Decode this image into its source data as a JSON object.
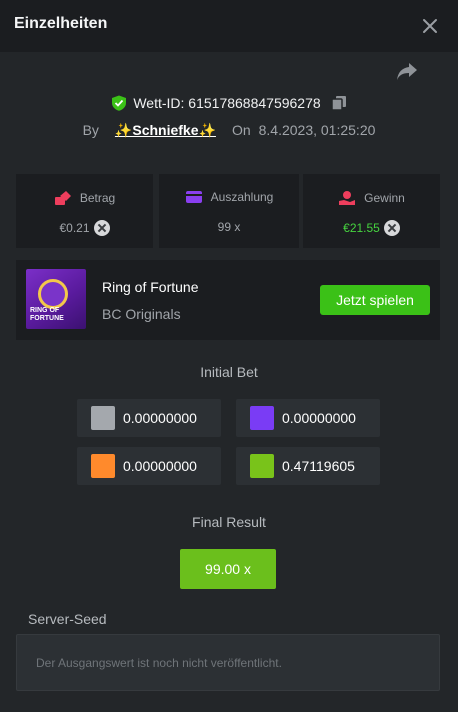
{
  "header": {
    "title": "Einzelheiten"
  },
  "bet": {
    "id_text": "Wett-ID: 61517868847596278",
    "by_label": "By",
    "user": "✨Schniefke✨",
    "on_label": "On",
    "timestamp": "8.4.2023, 01:25:20"
  },
  "stats": {
    "betrag": {
      "label": "Betrag",
      "value": "€0.21"
    },
    "auszahlung": {
      "label": "Auszahlung",
      "value": "99 x"
    },
    "gewinn": {
      "label": "Gewinn",
      "value": "€21.55"
    }
  },
  "game": {
    "name": "Ring of Fortune",
    "provider": "BC Originals",
    "play_label": "Jetzt spielen",
    "thumb_text": "RING OF FORTUNE"
  },
  "initial_bet": {
    "label": "Initial Bet",
    "items": [
      {
        "color": "#a4a8ad",
        "value": "0.00000000"
      },
      {
        "color": "#7a3cf5",
        "value": "0.00000000"
      },
      {
        "color": "#ff8a2c",
        "value": "0.00000000"
      },
      {
        "color": "#79c31a",
        "value": "0.47119605"
      }
    ]
  },
  "final_result": {
    "label": "Final Result",
    "value": "99.00 x"
  },
  "server_seed": {
    "label": "Server-Seed",
    "placeholder": "Der Ausgangswert ist noch nicht veröffentlicht."
  },
  "colors": {
    "accent_green": "#3bc117",
    "win_green": "#46d43f",
    "panel": "#1b1d20",
    "background": "#232629"
  }
}
